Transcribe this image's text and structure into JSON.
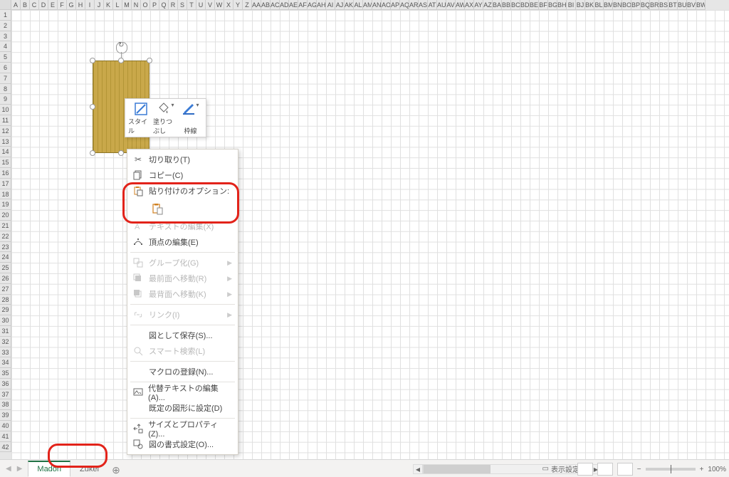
{
  "columns": [
    "A",
    "B",
    "C",
    "D",
    "E",
    "F",
    "G",
    "H",
    "I",
    "J",
    "K",
    "L",
    "M",
    "N",
    "O",
    "P",
    "Q",
    "R",
    "S",
    "T",
    "U",
    "V",
    "W",
    "X",
    "Y",
    "Z",
    "AA",
    "AB",
    "AC",
    "AD",
    "AE",
    "AF",
    "AG",
    "AH",
    "AI",
    "AJ",
    "AK",
    "AL",
    "AM",
    "AN",
    "AO",
    "AP",
    "AQ",
    "AR",
    "AS",
    "AT",
    "AU",
    "AV",
    "AW",
    "AX",
    "AY",
    "AZ",
    "BA",
    "BB",
    "BC",
    "BD",
    "BE",
    "BF",
    "BG",
    "BH",
    "BI",
    "BJ",
    "BK",
    "BL",
    "BM",
    "BN",
    "BO",
    "BP",
    "BQ",
    "BR",
    "BS",
    "BT",
    "BU",
    "BV",
    "BW"
  ],
  "row_count": 42,
  "mini_toolbar": {
    "style": "スタイル",
    "fill": "塗りつぶし",
    "outline": "枠線"
  },
  "context_menu": {
    "cut": "切り取り(T)",
    "copy": "コピー(C)",
    "paste_options": "貼り付けのオプション:",
    "edit_text": "テキストの編集(X)",
    "edit_points": "頂点の編集(E)",
    "group": "グループ化(G)",
    "bring_front": "最前面へ移動(R)",
    "send_back": "最背面へ移動(K)",
    "link": "リンク(I)",
    "save_picture": "図として保存(S)...",
    "smart_lookup": "スマート検索(L)",
    "assign_macro": "マクロの登録(N)...",
    "alt_text": "代替テキストの編集(A)...",
    "set_default": "既定の図形に設定(D)",
    "size_props": "サイズとプロパティ(Z)...",
    "format_shape": "図の書式設定(O)..."
  },
  "tabs": {
    "active": "Madori",
    "inactive": "Zukei"
  },
  "status": {
    "display_settings": "表示設定",
    "zoom": "100%"
  }
}
